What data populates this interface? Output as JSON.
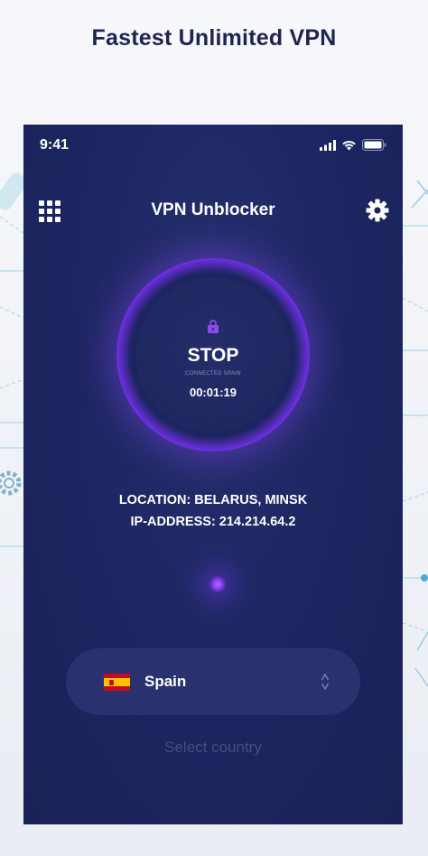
{
  "headline": "Fastest Unlimited VPN",
  "status_bar": {
    "time": "9:41"
  },
  "app_bar": {
    "title": "VPN Unblocker",
    "menu_icon": "grid-icon",
    "settings_icon": "gear-icon"
  },
  "connection": {
    "button_label": "STOP",
    "status_text": "CONNECTED SPAIN",
    "timer": "00:01:19",
    "lock_icon": "lock-icon"
  },
  "info": {
    "location": "LOCATION: BELARUS, MINSK",
    "ip_address": "IP-ADDRESS: 214.214.64.2"
  },
  "country_selector": {
    "selected_country": "Spain",
    "flag_icon": "spain-flag-icon",
    "chevron_icon": "up-down-chevron-icon",
    "caption": "Select country"
  },
  "colors": {
    "phone_background": "#1d2560",
    "ring_accent": "#8f4cff",
    "pill_background": "#29316f",
    "headline_color": "#1c2550"
  }
}
